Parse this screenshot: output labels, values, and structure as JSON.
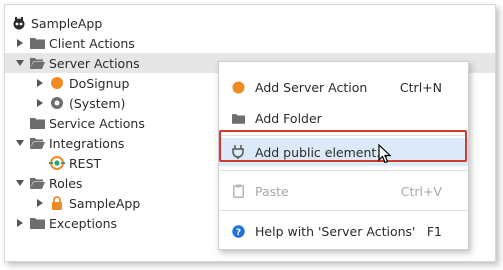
{
  "tree": {
    "root": {
      "label": "SampleApp",
      "icon": "robot-app-icon"
    },
    "items": [
      {
        "label": "Client Actions",
        "icon": "folder-icon",
        "expanded": false
      },
      {
        "label": "Server Actions",
        "icon": "folder-open-icon",
        "expanded": true
      },
      {
        "label": "DoSignup",
        "icon": "server-action-icon"
      },
      {
        "label": "(System)",
        "icon": "system-module-icon"
      },
      {
        "label": "Service Actions",
        "icon": "folder-icon"
      },
      {
        "label": "Integrations",
        "icon": "folder-open-icon",
        "expanded": true
      },
      {
        "label": "REST",
        "icon": "rest-api-icon"
      },
      {
        "label": "Roles",
        "icon": "folder-open-icon",
        "expanded": true
      },
      {
        "label": "SampleApp",
        "icon": "lock-icon"
      },
      {
        "label": "Exceptions",
        "icon": "folder-icon",
        "expanded": false
      }
    ]
  },
  "context_menu": {
    "items": [
      {
        "label": "Add Server Action",
        "shortcut": "Ctrl+N",
        "icon": "server-action-icon"
      },
      {
        "label": "Add Folder",
        "shortcut": "",
        "icon": "folder-icon"
      },
      {
        "label": "Add public element...",
        "shortcut": "",
        "icon": "plug-icon"
      },
      {
        "label": "Paste",
        "shortcut": "Ctrl+V",
        "icon": "clipboard-icon"
      },
      {
        "label": "Help with 'Server Actions'",
        "shortcut": "F1",
        "icon": "help-icon"
      }
    ]
  },
  "colors": {
    "accent_orange": "#f08a24",
    "highlight_border": "#cf3b2d",
    "hover_bg": "#dbe9f9",
    "help_blue": "#1e74d2"
  }
}
